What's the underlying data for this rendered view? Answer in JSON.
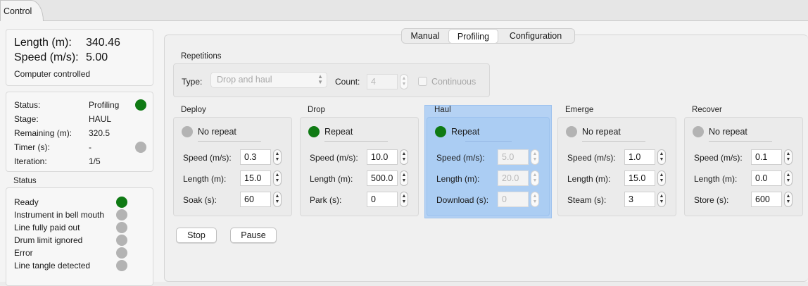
{
  "tab": {
    "label": "Control"
  },
  "summary": {
    "length_label": "Length (m):",
    "length_value": "340.46",
    "speed_label": "Speed (m/s):",
    "speed_value": "5.00",
    "mode": "Computer controlled"
  },
  "state": [
    {
      "label": "Status:",
      "value": "Profiling"
    },
    {
      "label": "Stage:",
      "value": "HAUL"
    },
    {
      "label": "Remaining (m):",
      "value": "320.5"
    },
    {
      "label": "Timer (s):",
      "value": "-"
    },
    {
      "label": "Iteration:",
      "value": "1/5"
    }
  ],
  "status": {
    "title": "Status",
    "items": [
      "Ready",
      "Instrument in bell mouth",
      "Line fully paid out",
      "Drum limit ignored",
      "Error",
      "Line tangle detected"
    ]
  },
  "segments": [
    "Manual",
    "Profiling",
    "Configuration"
  ],
  "repetitions": {
    "title": "Repetitions",
    "type_label": "Type:",
    "type_value": "Drop and haul",
    "count_label": "Count:",
    "count_value": "4",
    "continuous_label": "Continuous"
  },
  "stages": [
    {
      "title": "Deploy",
      "mode": "No repeat",
      "rows": [
        {
          "label": "Speed (m/s):",
          "value": "0.3"
        },
        {
          "label": "Length (m):",
          "value": "15.0"
        },
        {
          "label": "Soak (s):",
          "value": "60"
        }
      ]
    },
    {
      "title": "Drop",
      "mode": "Repeat",
      "rows": [
        {
          "label": "Speed (m/s):",
          "value": "10.0"
        },
        {
          "label": "Length (m):",
          "value": "500.0"
        },
        {
          "label": "Park (s):",
          "value": "0"
        }
      ]
    },
    {
      "title": "Haul",
      "mode": "Repeat",
      "rows": [
        {
          "label": "Speed (m/s):",
          "value": "5.0"
        },
        {
          "label": "Length (m):",
          "value": "20.0"
        },
        {
          "label": "Download (s):",
          "value": "0"
        }
      ]
    },
    {
      "title": "Emerge",
      "mode": "No repeat",
      "rows": [
        {
          "label": "Speed (m/s):",
          "value": "1.0"
        },
        {
          "label": "Length (m):",
          "value": "15.0"
        },
        {
          "label": "Steam (s):",
          "value": "3"
        }
      ]
    },
    {
      "title": "Recover",
      "mode": "No repeat",
      "rows": [
        {
          "label": "Speed (m/s):",
          "value": "0.1"
        },
        {
          "label": "Length (m):",
          "value": "0.0"
        },
        {
          "label": "Store (s):",
          "value": "600"
        }
      ]
    }
  ],
  "buttons": {
    "stop": "Stop",
    "pause": "Pause"
  },
  "colors": {
    "active_green": "#0f7a14",
    "inactive_gray": "#b3b3b3",
    "highlight_blue": "#b5d2f4"
  }
}
